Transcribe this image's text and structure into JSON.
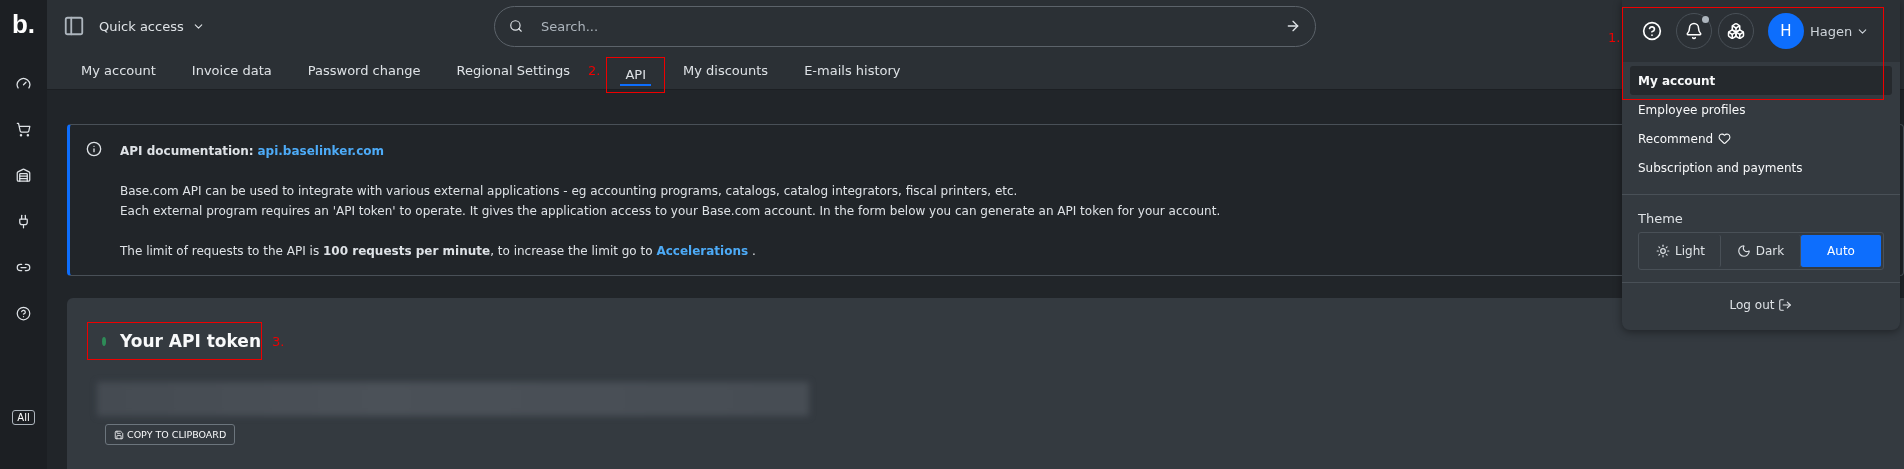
{
  "sidebar": {
    "logo": "b.",
    "badge": "All"
  },
  "topbar": {
    "quick_access": "Quick access",
    "search": {
      "placeholder": "Search..."
    }
  },
  "tabs": [
    {
      "label": "My account",
      "selected": false
    },
    {
      "label": "Invoice data",
      "selected": false
    },
    {
      "label": "Password change",
      "selected": false
    },
    {
      "label": "Regional Settings",
      "selected": false
    },
    {
      "label": "API",
      "selected": true,
      "annotation": "2."
    },
    {
      "label": "My discounts",
      "selected": false
    },
    {
      "label": "E-mails history",
      "selected": false
    }
  ],
  "info": {
    "title": "API documentation:",
    "link": "api.baselinker.com",
    "lines": [
      "Base.com API can be used to integrate with various external applications - eg accounting programs, catalogs, catalog integrators, fiscal printers, etc.",
      "Each external program requires an 'API token' to operate. It gives the application access to your Base.com account. In the form below you can generate an API token for your account."
    ],
    "limit_text": "The limit of requests to the API is **100 requests per minute**, to increase the limit go to",
    "limit_link": "Accelerations",
    "limit_end": "."
  },
  "token_card": {
    "title": "Your API token",
    "active": true,
    "annotation": "3.",
    "copy_button": "COPY TO CLIPBOARD"
  },
  "account_menu": {
    "annotation": "1.",
    "notification_dot": true,
    "avatar": "H",
    "user": "Hagen",
    "items": [
      {
        "label": "My account",
        "selected": true,
        "kind": "plain"
      },
      {
        "label": "Employee profiles",
        "selected": false,
        "kind": "plain"
      },
      {
        "label": "Recommend",
        "selected": false,
        "kind": "heart"
      },
      {
        "label": "Subscription and payments",
        "selected": false,
        "kind": "plain"
      }
    ],
    "theme_label": "Theme",
    "themes": [
      {
        "label": "Light",
        "selected": false
      },
      {
        "label": "Dark",
        "selected": false
      },
      {
        "label": "Auto",
        "selected": true
      }
    ],
    "logout": "Log out"
  }
}
